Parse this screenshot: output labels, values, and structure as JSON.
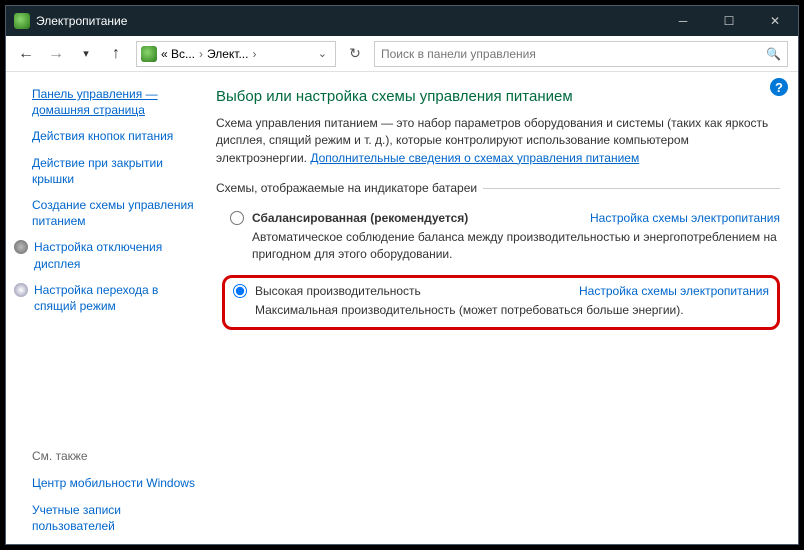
{
  "titlebar": {
    "title": "Электропитание"
  },
  "breadcrumb": {
    "item1": "« Вс...",
    "item2": "Элект..."
  },
  "search": {
    "placeholder": "Поиск в панели управления"
  },
  "sidebar": {
    "home": "Панель управления — домашняя страница",
    "links": [
      "Действия кнопок питания",
      "Действие при закрытии крышки",
      "Создание схемы управления питанием",
      "Настройка отключения дисплея",
      "Настройка перехода в спящий режим"
    ],
    "see_also_heading": "См. также",
    "see_also": [
      "Центр мобильности Windows",
      "Учетные записи пользователей"
    ]
  },
  "content": {
    "title": "Выбор или настройка схемы управления питанием",
    "description": "Схема управления питанием — это набор параметров оборудования и системы (таких как яркость дисплея, спящий режим и т. д.), которые контролируют использование компьютером электроэнергии. ",
    "more_info_link": "Дополнительные сведения о схемах управления питанием",
    "legend": "Схемы, отображаемые на индикаторе батареи",
    "plan_settings_link": "Настройка схемы электропитания",
    "plans": [
      {
        "name": "Сбалансированная (рекомендуется)",
        "desc": "Автоматическое соблюдение баланса между производительностью и энергопотреблением на пригодном для этого оборудовании.",
        "selected": false
      },
      {
        "name": "Высокая производительность",
        "desc": "Максимальная производительность (может потребоваться больше энергии).",
        "selected": true
      }
    ]
  }
}
